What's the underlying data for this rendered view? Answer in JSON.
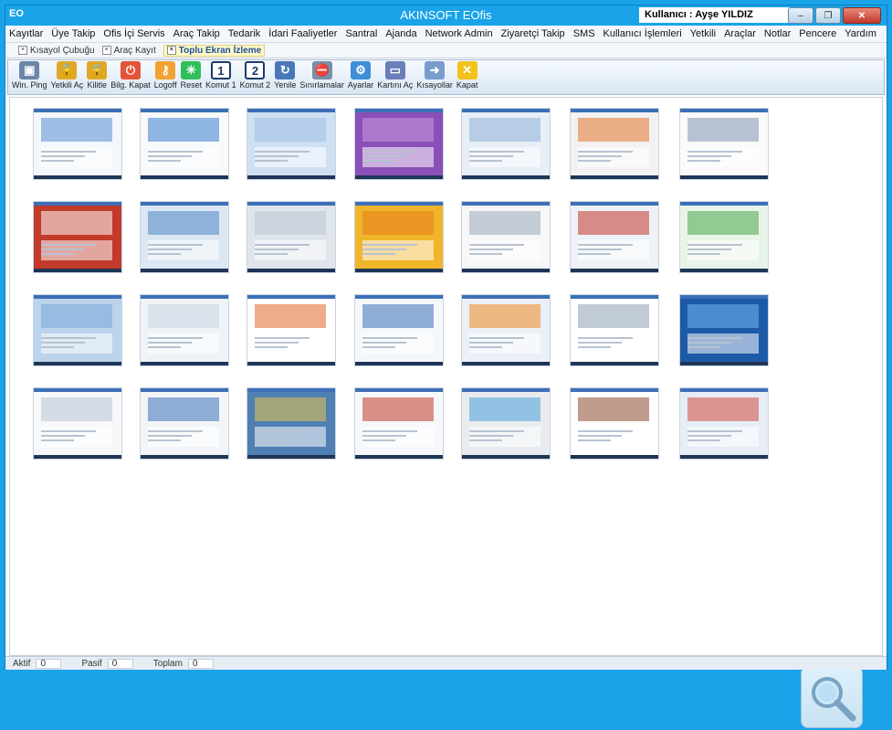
{
  "window": {
    "app_icon": "EO",
    "title": "AKINSOFT EOfis",
    "user_label": "Kullanıcı : Ayşe YILDIZ",
    "controls": [
      "minimize-icon",
      "restore-icon",
      "close-icon"
    ]
  },
  "menu": [
    "Kayıtlar",
    "Üye Takip",
    "Ofis İçi Servis",
    "Araç Takip",
    "Tedarik",
    "İdari Faaliyetler",
    "Santral",
    "Ajanda",
    "Network Admin",
    "Ziyaretçi Takip",
    "SMS",
    "Kullanıcı İşlemleri",
    "Yetkili",
    "Araçlar",
    "Notlar",
    "Pencere",
    "Yardım"
  ],
  "tabs": [
    {
      "label": "Kısayol Çubuğu",
      "active": false
    },
    {
      "label": "Araç Kayıt",
      "active": false
    },
    {
      "label": "Toplu Ekran İzleme",
      "active": true
    }
  ],
  "toolbar": [
    {
      "label": "Win. Ping",
      "icon": "monitor-ping-icon",
      "color": "#6b86a8"
    },
    {
      "label": "Yetkili Aç",
      "icon": "unlock-icon",
      "color": "#e0a826"
    },
    {
      "label": "Kilitle",
      "icon": "lock-icon",
      "color": "#e0a826"
    },
    {
      "label": "Bilg. Kapat",
      "icon": "power-icon",
      "color": "#e2533a"
    },
    {
      "label": "Logoff",
      "icon": "key-icon",
      "color": "#f1a232"
    },
    {
      "label": "Reset",
      "icon": "reset-icon",
      "color": "#2fbf5a"
    },
    {
      "label": "Komut 1",
      "icon": "command-1-icon",
      "color": "#2b5ea8"
    },
    {
      "label": "Komut 2",
      "icon": "command-2-icon",
      "color": "#2b5ea8"
    },
    {
      "label": "Yenile",
      "icon": "refresh-icon",
      "color": "#4a77b8"
    },
    {
      "label": "Sınırlamalar",
      "icon": "restrictions-icon",
      "color": "#7a8ea6"
    },
    {
      "label": "Ayarlar",
      "icon": "settings-icon",
      "color": "#3f8ed8"
    },
    {
      "label": "Kartını Aç",
      "icon": "card-open-icon",
      "color": "#6b7fb8"
    },
    {
      "label": "Kısayollar",
      "icon": "shortcuts-icon",
      "color": "#7a9ccc"
    },
    {
      "label": "Kapat",
      "icon": "exit-icon",
      "color": "#f2c21a"
    }
  ],
  "thumbnails": [
    {
      "name": "screen-1",
      "bg": "#f4f7fb",
      "accent": "#5b8ed6"
    },
    {
      "name": "screen-2",
      "bg": "#f7f9fb",
      "accent": "#3a7fcf"
    },
    {
      "name": "screen-3",
      "bg": "#cfe0f3",
      "accent": "#9fbde2"
    },
    {
      "name": "screen-4",
      "bg": "#8a4fb8",
      "accent": "#c79ae0"
    },
    {
      "name": "screen-5",
      "bg": "#e7eef6",
      "accent": "#8fb3d8"
    },
    {
      "name": "screen-6",
      "bg": "#f2f2f2",
      "accent": "#e2762b"
    },
    {
      "name": "screen-7",
      "bg": "#fafafa",
      "accent": "#7f96b1"
    },
    {
      "name": "screen-8",
      "bg": "#c23a2a",
      "accent": "#ffffff"
    },
    {
      "name": "screen-9",
      "bg": "#dbe7f2",
      "accent": "#4f86c6"
    },
    {
      "name": "screen-10",
      "bg": "#dfe5ea",
      "accent": "#b9c5d1"
    },
    {
      "name": "screen-11",
      "bg": "#f1b52a",
      "accent": "#e47c1c"
    },
    {
      "name": "screen-12",
      "bg": "#f7f7f7",
      "accent": "#9aa9bb"
    },
    {
      "name": "screen-13",
      "bg": "#eef2f6",
      "accent": "#c2372a"
    },
    {
      "name": "screen-14",
      "bg": "#e9f4e9",
      "accent": "#49a84b"
    },
    {
      "name": "screen-15",
      "bg": "#bcd3ec",
      "accent": "#79a7d8"
    },
    {
      "name": "screen-16",
      "bg": "#eef3f8",
      "accent": "#c9d3de"
    },
    {
      "name": "screen-17",
      "bg": "#ffffff",
      "accent": "#e2682b"
    },
    {
      "name": "screen-18",
      "bg": "#f5f8fb",
      "accent": "#3d6fb8"
    },
    {
      "name": "screen-19",
      "bg": "#eaf0f6",
      "accent": "#f08a24"
    },
    {
      "name": "screen-20",
      "bg": "#ffffff",
      "accent": "#8ea0b5"
    },
    {
      "name": "screen-21",
      "bg": "#1d5aa8",
      "accent": "#6fb6ef"
    },
    {
      "name": "screen-22",
      "bg": "#f6f8fa",
      "accent": "#b7c3d1"
    },
    {
      "name": "screen-23",
      "bg": "#f2f5f8",
      "accent": "#3d6fb8"
    },
    {
      "name": "screen-24",
      "bg": "#4f7fb3",
      "accent": "#e7c24a"
    },
    {
      "name": "screen-25",
      "bg": "#f6f8fb",
      "accent": "#c23a2a"
    },
    {
      "name": "screen-26",
      "bg": "#e9ecef",
      "accent": "#4aa0d8"
    },
    {
      "name": "screen-27",
      "bg": "#ffffff",
      "accent": "#8a4a2b"
    },
    {
      "name": "screen-28",
      "bg": "#e6edf5",
      "accent": "#d24a3a"
    }
  ],
  "status": [
    {
      "label": "Aktif",
      "value": "0"
    },
    {
      "label": "Pasif",
      "value": "0"
    },
    {
      "label": "Toplam",
      "value": "0"
    }
  ]
}
